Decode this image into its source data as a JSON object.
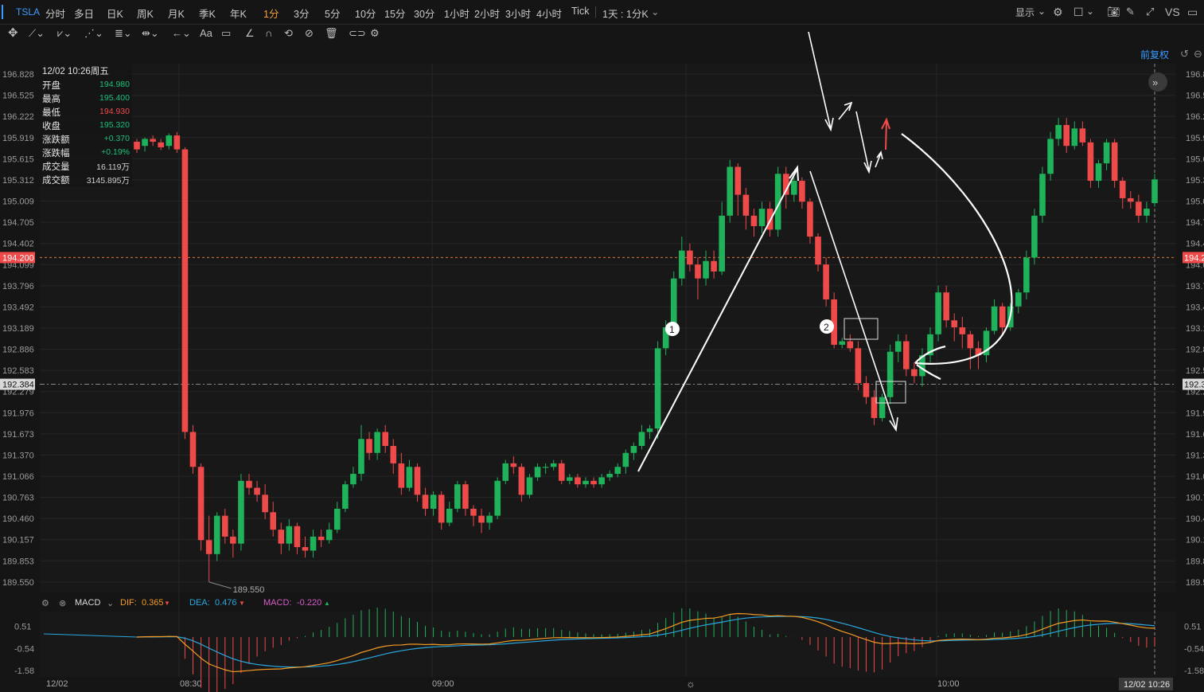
{
  "header": {
    "symbol": "TSLA",
    "tabs": [
      "分时",
      "多日",
      "日K",
      "周K",
      "月K",
      "季K",
      "年K",
      "1分",
      "3分",
      "5分",
      "10分",
      "15分",
      "30分",
      "1小时",
      "2小时",
      "3小时",
      "4小时",
      "Tick"
    ],
    "active_tab": "1分",
    "range_select": "1天 : 1分K",
    "display_label": "显示",
    "vs_label": "VS"
  },
  "toolbar": {
    "text_tool": "Aa"
  },
  "adjust_label": "前复权",
  "info_panel": {
    "datetime": "12/02 10:26周五",
    "rows": [
      {
        "label": "开盘",
        "value": "194.980",
        "color": "#19c17a"
      },
      {
        "label": "最高",
        "value": "195.400",
        "color": "#19c17a"
      },
      {
        "label": "最低",
        "value": "194.930",
        "color": "#ef4a4a"
      },
      {
        "label": "收盘",
        "value": "195.320",
        "color": "#19c17a"
      },
      {
        "label": "涨跌额",
        "value": "+0.370",
        "color": "#19c17a"
      },
      {
        "label": "涨跌幅",
        "value": "+0.19%",
        "color": "#19c17a"
      },
      {
        "label": "成交量",
        "value": "16.119万",
        "color": "#cfcfcf"
      },
      {
        "label": "成交额",
        "value": "3145.895万",
        "color": "#cfcfcf"
      }
    ]
  },
  "chart_data": {
    "type": "candlestick",
    "price_ticks": [
      "196.828",
      "196.525",
      "196.222",
      "195.919",
      "195.615",
      "195.312",
      "195.009",
      "194.705",
      "194.402",
      "194.099",
      "193.796",
      "193.492",
      "193.189",
      "192.886",
      "192.583",
      "192.279",
      "191.976",
      "191.673",
      "191.370",
      "191.066",
      "190.763",
      "190.460",
      "190.157",
      "189.853",
      "189.550"
    ],
    "ref_line_price": "194.200",
    "crosshair_price": "192.384",
    "low_annotation": "189.550",
    "x_labels": [
      "12/02",
      "08:30",
      "09:00",
      "10:00"
    ],
    "crosshair_time": "12/02 10:26",
    "candles": [
      [
        195.86,
        195.75,
        195.9,
        195.7
      ],
      [
        195.8,
        195.9,
        195.92,
        195.72
      ],
      [
        195.9,
        195.86,
        195.95,
        195.8
      ],
      [
        195.85,
        195.78,
        195.9,
        195.74
      ],
      [
        195.8,
        195.95,
        195.98,
        195.75
      ],
      [
        195.95,
        195.75,
        196.0,
        195.7
      ],
      [
        195.75,
        191.7,
        195.78,
        191.6
      ],
      [
        191.7,
        191.2,
        191.8,
        191.1
      ],
      [
        191.2,
        190.15,
        191.25,
        190.0
      ],
      [
        190.15,
        189.95,
        190.5,
        189.55
      ],
      [
        189.95,
        190.5,
        190.55,
        189.85
      ],
      [
        190.5,
        190.2,
        190.6,
        190.1
      ],
      [
        190.2,
        190.1,
        190.3,
        189.9
      ],
      [
        190.1,
        191.0,
        191.1,
        190.0
      ],
      [
        191.0,
        190.9,
        191.1,
        190.8
      ],
      [
        190.9,
        190.8,
        191.0,
        190.7
      ],
      [
        190.8,
        190.55,
        190.95,
        190.45
      ],
      [
        190.55,
        190.3,
        190.7,
        190.2
      ],
      [
        190.3,
        190.1,
        190.4,
        189.95
      ],
      [
        190.1,
        190.35,
        190.45,
        190.0
      ],
      [
        190.35,
        190.05,
        190.4,
        189.95
      ],
      [
        190.05,
        190.0,
        190.2,
        189.9
      ],
      [
        190.0,
        190.2,
        190.3,
        189.9
      ],
      [
        190.2,
        190.15,
        190.3,
        190.05
      ],
      [
        190.15,
        190.3,
        190.4,
        190.1
      ],
      [
        190.3,
        190.6,
        190.7,
        190.25
      ],
      [
        190.6,
        190.95,
        191.0,
        190.55
      ],
      [
        190.95,
        191.1,
        191.2,
        190.9
      ],
      [
        191.1,
        191.6,
        191.8,
        191.0
      ],
      [
        191.6,
        191.4,
        191.7,
        191.3
      ],
      [
        191.4,
        191.7,
        191.75,
        191.3
      ],
      [
        191.7,
        191.5,
        191.8,
        191.4
      ],
      [
        191.5,
        191.25,
        191.6,
        191.1
      ],
      [
        191.25,
        190.9,
        191.4,
        190.8
      ],
      [
        190.9,
        191.2,
        191.3,
        190.85
      ],
      [
        191.2,
        190.8,
        191.25,
        190.7
      ],
      [
        190.8,
        190.6,
        190.9,
        190.5
      ],
      [
        190.6,
        190.8,
        190.85,
        190.5
      ],
      [
        190.8,
        190.4,
        190.85,
        190.3
      ],
      [
        190.4,
        190.6,
        190.7,
        190.35
      ],
      [
        190.6,
        190.95,
        191.0,
        190.55
      ],
      [
        190.95,
        190.6,
        191.0,
        190.5
      ],
      [
        190.6,
        190.5,
        190.65,
        190.35
      ],
      [
        190.5,
        190.4,
        190.6,
        190.25
      ],
      [
        190.4,
        190.5,
        190.55,
        190.3
      ],
      [
        190.5,
        191.0,
        191.05,
        190.45
      ],
      [
        191.0,
        191.25,
        191.3,
        190.95
      ],
      [
        191.25,
        191.2,
        191.35,
        191.1
      ],
      [
        191.2,
        190.8,
        191.25,
        190.7
      ],
      [
        190.8,
        191.05,
        191.1,
        190.75
      ],
      [
        191.05,
        191.2,
        191.25,
        191.0
      ],
      [
        191.2,
        191.2,
        191.25,
        191.1
      ],
      [
        191.2,
        191.25,
        191.3,
        191.15
      ],
      [
        191.25,
        191.0,
        191.3,
        190.95
      ],
      [
        191.0,
        191.05,
        191.1,
        190.95
      ],
      [
        191.05,
        190.95,
        191.1,
        190.9
      ],
      [
        190.95,
        191.0,
        191.05,
        190.9
      ],
      [
        191.0,
        190.95,
        191.05,
        190.9
      ],
      [
        190.95,
        191.05,
        191.1,
        190.9
      ],
      [
        191.05,
        191.1,
        191.15,
        191.0
      ],
      [
        191.1,
        191.2,
        191.25,
        191.05
      ],
      [
        191.2,
        191.4,
        191.45,
        191.1
      ],
      [
        191.4,
        191.5,
        191.55,
        191.3
      ],
      [
        191.5,
        191.7,
        191.8,
        191.45
      ],
      [
        191.7,
        191.75,
        191.8,
        191.6
      ],
      [
        191.75,
        192.9,
        193.0,
        191.6
      ],
      [
        192.9,
        193.2,
        193.3,
        192.8
      ],
      [
        193.2,
        193.9,
        194.0,
        193.1
      ],
      [
        193.9,
        194.3,
        194.5,
        193.8
      ],
      [
        194.3,
        194.1,
        194.4,
        194.0
      ],
      [
        194.1,
        193.9,
        194.2,
        193.6
      ],
      [
        193.9,
        194.15,
        194.3,
        193.8
      ],
      [
        194.15,
        194.0,
        194.3,
        193.9
      ],
      [
        194.0,
        194.8,
        195.0,
        193.95
      ],
      [
        194.8,
        195.5,
        195.6,
        194.7
      ],
      [
        195.5,
        195.1,
        195.55,
        194.8
      ],
      [
        195.1,
        194.8,
        195.2,
        194.6
      ],
      [
        194.8,
        194.65,
        194.9,
        194.5
      ],
      [
        194.65,
        194.9,
        195.0,
        194.55
      ],
      [
        194.9,
        194.6,
        195.0,
        194.5
      ],
      [
        194.6,
        195.4,
        195.5,
        194.5
      ],
      [
        195.4,
        195.1,
        195.5,
        194.9
      ],
      [
        195.1,
        195.3,
        195.35,
        195.0
      ],
      [
        195.3,
        195.0,
        195.35,
        194.9
      ],
      [
        195.0,
        194.5,
        195.05,
        194.4
      ],
      [
        194.5,
        194.1,
        194.55,
        194.0
      ],
      [
        194.1,
        193.6,
        194.2,
        193.5
      ],
      [
        193.6,
        192.95,
        193.7,
        192.9
      ],
      [
        192.95,
        193.0,
        193.05,
        192.9
      ],
      [
        193.0,
        192.9,
        193.1,
        192.85
      ],
      [
        192.9,
        192.4,
        193.0,
        192.3
      ],
      [
        192.4,
        192.2,
        192.5,
        192.1
      ],
      [
        192.2,
        191.9,
        192.3,
        191.8
      ],
      [
        191.9,
        192.2,
        192.25,
        191.85
      ],
      [
        192.2,
        192.85,
        192.95,
        192.1
      ],
      [
        192.85,
        193.0,
        193.1,
        192.7
      ],
      [
        193.0,
        192.6,
        193.1,
        192.5
      ],
      [
        192.6,
        192.5,
        192.7,
        192.4
      ],
      [
        192.5,
        192.8,
        192.9,
        192.35
      ],
      [
        192.8,
        193.1,
        193.2,
        192.7
      ],
      [
        193.1,
        193.7,
        193.8,
        193.0
      ],
      [
        193.7,
        193.3,
        193.8,
        193.2
      ],
      [
        193.3,
        193.2,
        193.4,
        193.0
      ],
      [
        193.2,
        193.1,
        193.35,
        192.9
      ],
      [
        193.1,
        192.9,
        193.15,
        192.6
      ],
      [
        192.9,
        192.8,
        193.0,
        192.6
      ],
      [
        192.8,
        193.15,
        193.2,
        192.7
      ],
      [
        193.15,
        193.5,
        193.6,
        193.1
      ],
      [
        193.5,
        193.2,
        193.55,
        193.1
      ],
      [
        193.2,
        193.5,
        193.55,
        193.15
      ],
      [
        193.5,
        193.7,
        193.75,
        193.4
      ],
      [
        193.7,
        194.2,
        194.3,
        193.6
      ],
      [
        194.2,
        194.8,
        194.9,
        194.1
      ],
      [
        194.8,
        195.4,
        195.5,
        194.7
      ],
      [
        195.4,
        195.9,
        196.0,
        195.3
      ],
      [
        195.9,
        196.1,
        196.2,
        195.8
      ],
      [
        196.1,
        195.8,
        196.2,
        195.7
      ],
      [
        195.8,
        196.05,
        196.15,
        195.75
      ],
      [
        196.05,
        195.85,
        196.15,
        195.8
      ],
      [
        195.85,
        195.3,
        195.9,
        195.2
      ],
      [
        195.3,
        195.55,
        195.6,
        195.2
      ],
      [
        195.55,
        195.85,
        195.9,
        195.45
      ],
      [
        195.85,
        195.3,
        195.9,
        195.2
      ],
      [
        195.3,
        195.05,
        195.35,
        194.9
      ],
      [
        195.05,
        195.0,
        195.15,
        194.9
      ],
      [
        195.0,
        194.8,
        195.1,
        194.7
      ],
      [
        194.8,
        194.9,
        195.0,
        194.7
      ],
      [
        194.98,
        195.32,
        195.4,
        194.93
      ]
    ],
    "macd": {
      "label": "MACD",
      "dif_label": "DIF:",
      "dif_value": "0.365",
      "dea_label": "DEA:",
      "dea_value": "0.476",
      "macd_label": "MACD:",
      "macd_value": "-0.220",
      "ticks": [
        "0.51",
        "-0.54",
        "-1.58"
      ],
      "dif_color": "#f59a23",
      "dea_color": "#29a8e0",
      "macd_color": "#d65cc8"
    },
    "annotations": [
      {
        "label": "1"
      },
      {
        "label": "2"
      }
    ]
  },
  "colors": {
    "up": "#1fb25a",
    "down": "#ef4a4a",
    "accent": "#3b9bff"
  }
}
